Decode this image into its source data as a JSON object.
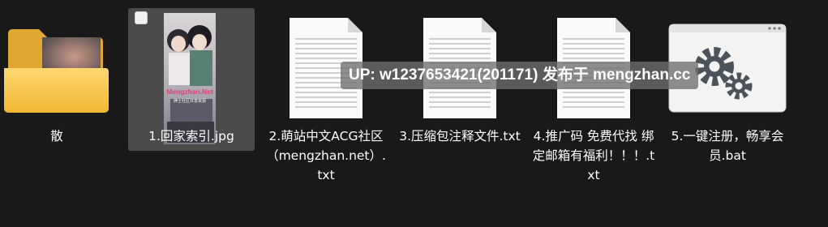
{
  "files": [
    {
      "name": "散",
      "type": "folder"
    },
    {
      "name": "1.回家索引.jpg",
      "type": "image",
      "selected": true,
      "cover_text": "Mengzhan.Net",
      "cover_subtext": "绅士社区共享资源"
    },
    {
      "name": "2.萌站中文ACG社区（mengzhan.net）.txt",
      "type": "text"
    },
    {
      "name": "3.压缩包注释文件.txt",
      "type": "text"
    },
    {
      "name": "4.推广码 免费代找 绑定邮箱有福利！！！.txt",
      "type": "text"
    },
    {
      "name": "5.一键注册，畅享会员.bat",
      "type": "batch"
    }
  ],
  "watermark": "UP: w1237653421(201171) 发布于 mengzhan.cc",
  "colors": {
    "background": "#191919",
    "selection": "#4b4b4b",
    "folder": "#f4c04a",
    "text": "#ffffff"
  },
  "icons": {
    "folder": "folder-icon",
    "image": "image-thumbnail",
    "text": "text-file-icon",
    "batch": "batch-file-icon"
  }
}
